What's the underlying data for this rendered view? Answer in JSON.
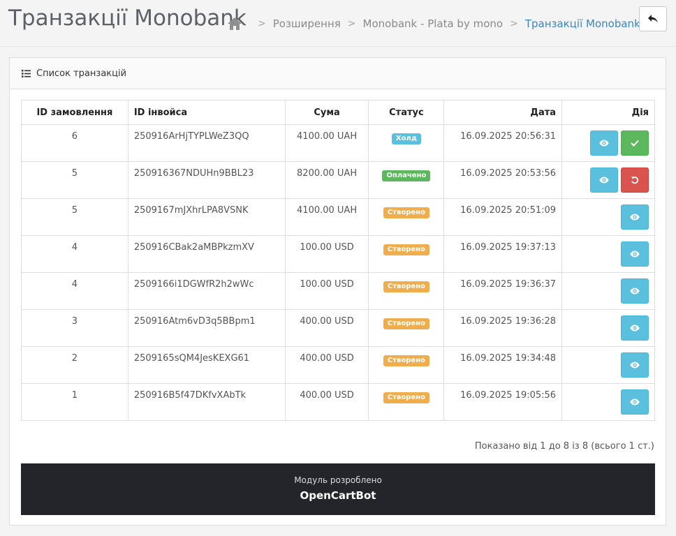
{
  "header": {
    "title": "Транзакції Monobank",
    "breadcrumbs": [
      "Розширення",
      "Monobank - Plata by mono",
      "Транзакції Monobank"
    ]
  },
  "panel": {
    "heading": "Список транзакцій"
  },
  "table": {
    "columns": [
      "ID замовлення",
      "ID інвойса",
      "Сума",
      "Статус",
      "Дата",
      "Дія"
    ],
    "rows": [
      {
        "order_id": "6",
        "invoice_id": "250916ArHjTYPLWeZ3QQ",
        "amount": "4100.00 UAH",
        "status": "Холд",
        "date": "16.09.2025 20:56:31"
      },
      {
        "order_id": "5",
        "invoice_id": "250916367NDUHn9BBL23",
        "amount": "8200.00 UAH",
        "status": "Оплачено",
        "date": "16.09.2025 20:53:56"
      },
      {
        "order_id": "5",
        "invoice_id": "2509167mJXhrLPA8VSNK",
        "amount": "4100.00 UAH",
        "status": "Створено",
        "date": "16.09.2025 20:51:09"
      },
      {
        "order_id": "4",
        "invoice_id": "250916CBak2aMBPkzmXV",
        "amount": "100.00 USD",
        "status": "Створено",
        "date": "16.09.2025 19:37:13"
      },
      {
        "order_id": "4",
        "invoice_id": "2509166i1DGWfR2h2wWc",
        "amount": "100.00 USD",
        "status": "Створено",
        "date": "16.09.2025 19:36:37"
      },
      {
        "order_id": "3",
        "invoice_id": "250916Atm6vD3q5BBpm1",
        "amount": "400.00 USD",
        "status": "Створено",
        "date": "16.09.2025 19:36:28"
      },
      {
        "order_id": "2",
        "invoice_id": "2509165sQM4JesKEXG61",
        "amount": "400.00 USD",
        "status": "Створено",
        "date": "16.09.2025 19:34:48"
      },
      {
        "order_id": "1",
        "invoice_id": "250916B5f47DKfvXAbTk",
        "amount": "400.00 USD",
        "status": "Створено",
        "date": "16.09.2025 19:05:56"
      }
    ]
  },
  "pagination": {
    "text": "Показано від 1 до 8 із 8 (всього 1 ст.)"
  },
  "footer": {
    "developed_by": "Модуль розроблено",
    "brand": "OpenCartBot"
  },
  "icons": {
    "home": "home-icon",
    "back": "reply-icon",
    "list": "list-icon",
    "view": "eye-icon",
    "confirm": "check-icon",
    "refund": "undo-icon"
  },
  "colors": {
    "status_hold": "#5bc0de",
    "status_paid": "#5cb85c",
    "status_created": "#f0ad4e",
    "btn_info": "#5bc0de",
    "btn_success": "#5cb85c",
    "btn_danger": "#d9534f",
    "breadcrumb_active": "#3a86c3",
    "footer_bg": "#23252a"
  }
}
